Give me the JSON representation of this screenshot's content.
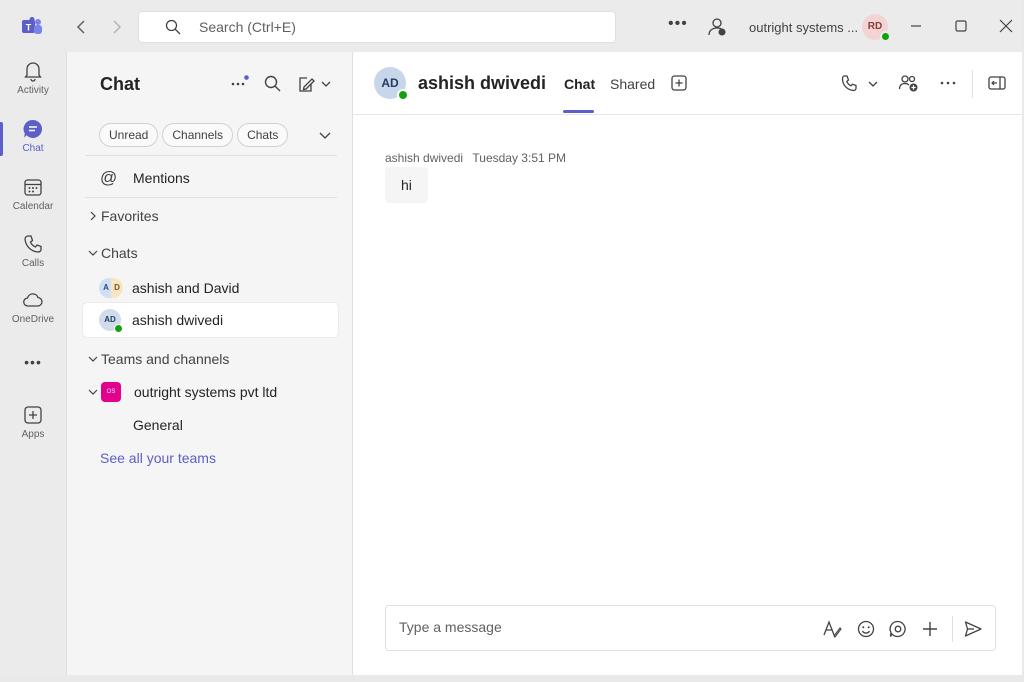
{
  "titlebar": {
    "search_placeholder": "Search (Ctrl+E)",
    "org_name": "outright systems ...",
    "user_initials": "RD"
  },
  "rail": {
    "items": [
      {
        "label": "Activity"
      },
      {
        "label": "Chat"
      },
      {
        "label": "Calendar"
      },
      {
        "label": "Calls"
      },
      {
        "label": "OneDrive"
      },
      {
        "label": "Apps"
      }
    ],
    "more_label": "•••"
  },
  "chat_pane": {
    "title": "Chat",
    "filters": [
      "Unread",
      "Channels",
      "Chats"
    ],
    "mentions_label": "Mentions",
    "favorites_label": "Favorites",
    "chats_label": "Chats",
    "chats": [
      {
        "name": "ashish and David",
        "initials_a": "A",
        "initials_b": "D"
      },
      {
        "name": "ashish dwivedi",
        "initials": "AD"
      }
    ],
    "teams_label": "Teams and channels",
    "team_name": "outright systems pvt ltd",
    "team_initials": "OS",
    "channel_name": "General",
    "see_all_label": "See all your teams"
  },
  "conversation": {
    "avatar_initials": "AD",
    "name": "ashish dwivedi",
    "tabs": [
      "Chat",
      "Shared"
    ],
    "messages": [
      {
        "sender": "ashish dwivedi",
        "time": "Tuesday 3:51 PM",
        "text": "hi"
      }
    ],
    "compose_placeholder": "Type a message"
  },
  "colors": {
    "accent": "#5b5fc7",
    "presence_available": "#13a10e",
    "team_tile": "#e3008c"
  }
}
